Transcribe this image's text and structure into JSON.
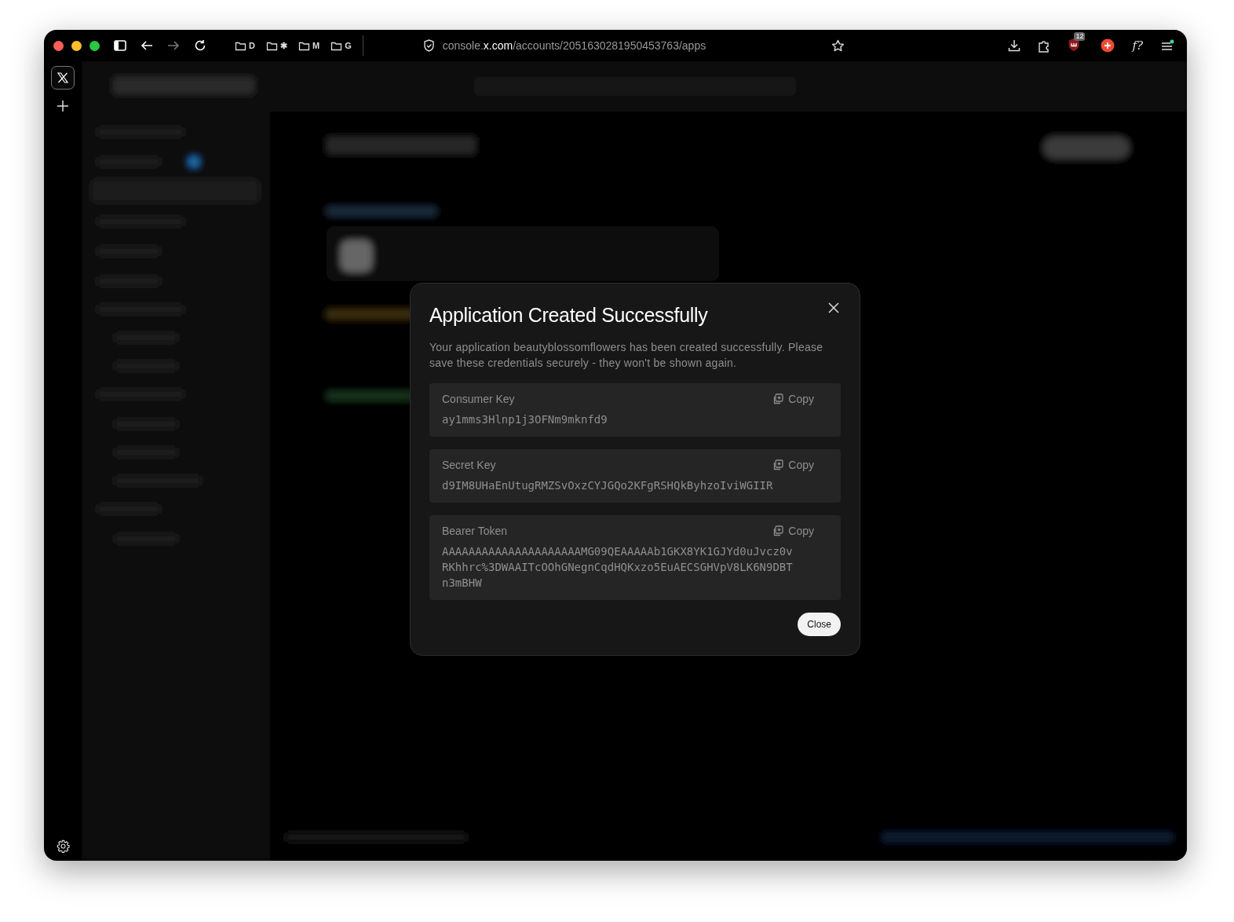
{
  "browser": {
    "bookmarks": [
      {
        "label": "D"
      },
      {
        "label": "✱"
      },
      {
        "label": "M"
      },
      {
        "label": "G"
      }
    ],
    "url": {
      "prefix": "console.",
      "domain": "x.com",
      "path": "/accounts/2051630281950453763/apps"
    },
    "extension_badge": "12",
    "extension_text": "f?"
  },
  "dialog": {
    "title": "Application Created Successfully",
    "message": "Your application beautyblossomflowers has been created successfully. Please save these credentials securely - they won't be shown again.",
    "credentials": [
      {
        "label": "Consumer Key",
        "value": "ay1mms3Hlnp1j3OFNm9mknfd9",
        "copy": "Copy"
      },
      {
        "label": "Secret Key",
        "value": "d9IM8UHaEnUtugRMZSvOxzCYJGQo2KFgRSHQkByhzoIviWGIIR",
        "copy": "Copy"
      },
      {
        "label": "Bearer Token",
        "value": "AAAAAAAAAAAAAAAAAAAAAMG09QEAAAAAb1GKX8YK1GJYd0uJvcz0vRKhhrc%3DWAAITcOOhGNegnCqdHQKxzo5EuAECSGHVpV8LK6N9DBTn3mBHW",
        "copy": "Copy"
      }
    ],
    "close_button": "Close"
  }
}
